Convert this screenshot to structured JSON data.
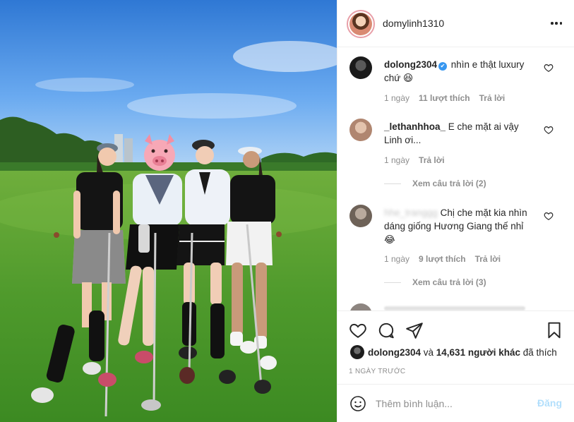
{
  "post": {
    "owner_username": "domylinh1310",
    "more_icon": "more-horizontal-icon"
  },
  "comments": [
    {
      "username": "dolong2304",
      "verified": true,
      "text": "nhìn e thật luxury chứ 😆",
      "time": "1 ngày",
      "likes": "11 lượt thích",
      "reply_label": "Trả lời",
      "avatar_color": "#1f1f1f"
    },
    {
      "username": "_lethanhhoa_",
      "verified": false,
      "text": "E che mặt ai vậy Linh ơi...",
      "time": "1 ngày",
      "reply_label": "Trả lời",
      "view_replies": "Xem câu trả lời (2)",
      "avatar_color": "#c9a58e"
    },
    {
      "username": "hhe_tranggg",
      "username_blurred": true,
      "verified": false,
      "text": "Chị che mặt kia nhìn dáng giống Hương Giang thế nhỉ 😂",
      "time": "1 ngày",
      "likes": "9 lượt thích",
      "reply_label": "Trả lời",
      "view_replies": "Xem câu trả lời (3)",
      "avatar_color": "#8a7d72"
    }
  ],
  "actions": {
    "like_icon": "heart-icon",
    "comment_icon": "comment-icon",
    "share_icon": "share-icon",
    "save_icon": "bookmark-icon"
  },
  "likes_summary": {
    "username": "dolong2304",
    "connector": " và ",
    "others": "14,631 người khác",
    "suffix": " đã thích"
  },
  "post_date": "1 NGÀY TRƯỚC",
  "comment_box": {
    "placeholder": "Thêm bình luận...",
    "post_label": "Đăng",
    "emoji_icon": "smile-icon"
  },
  "colors": {
    "link_blue_disabled": "#b2dffc",
    "verified_blue": "#3897f0",
    "secondary_text": "#8e8e8e"
  }
}
